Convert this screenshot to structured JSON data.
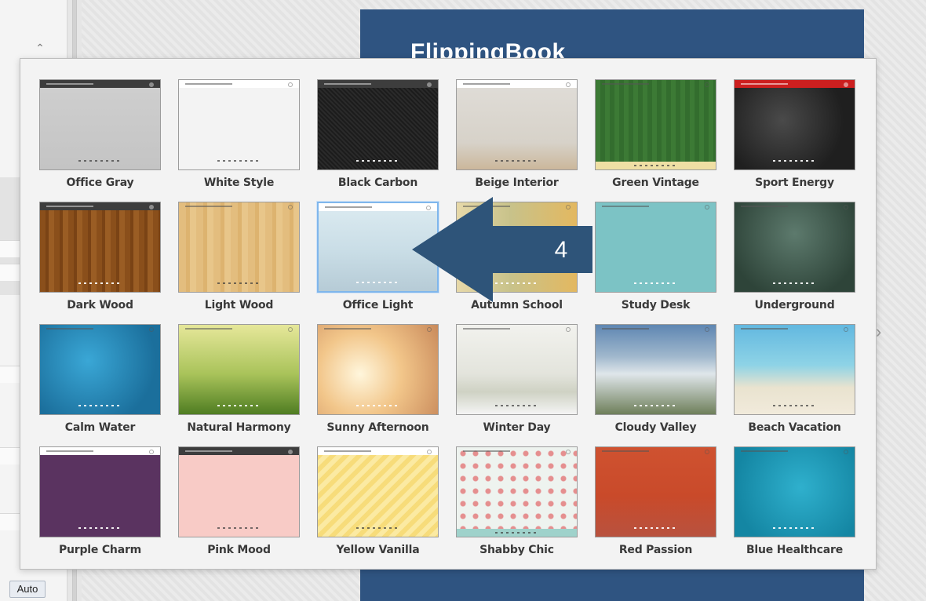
{
  "sidebar": {
    "auto_label": "Auto"
  },
  "book": {
    "logo_text": "FlippingBook"
  },
  "theme_picker": {
    "themes": [
      {
        "name": "Office Gray",
        "cls": "bg-office-gray",
        "bar": "dark",
        "icons": "dark"
      },
      {
        "name": "White Style",
        "cls": "bg-white-style",
        "bar": "light",
        "icons": "dark"
      },
      {
        "name": "Black Carbon",
        "cls": "bg-black-carbon",
        "bar": "dark",
        "icons": "light"
      },
      {
        "name": "Beige Interior",
        "cls": "bg-beige-interior",
        "bar": "light",
        "icons": "dark"
      },
      {
        "name": "Green Vintage",
        "cls": "bg-green-vintage",
        "bar": "clear",
        "icons": "band"
      },
      {
        "name": "Sport Energy",
        "cls": "bg-sport-energy",
        "bar": "red",
        "icons": "light"
      },
      {
        "name": "Dark Wood",
        "cls": "bg-dark-wood",
        "bar": "dark",
        "icons": "light"
      },
      {
        "name": "Light Wood",
        "cls": "bg-light-wood",
        "bar": "clear",
        "icons": "dark"
      },
      {
        "name": "Office Light",
        "cls": "bg-office-light",
        "bar": "light",
        "icons": "light",
        "selected": true
      },
      {
        "name": "Autumn School",
        "cls": "bg-autumn-school",
        "bar": "clear",
        "icons": "light"
      },
      {
        "name": "Study Desk",
        "cls": "bg-study-desk",
        "bar": "clear",
        "icons": "light"
      },
      {
        "name": "Underground",
        "cls": "bg-underground",
        "bar": "clear",
        "icons": "light"
      },
      {
        "name": "Calm Water",
        "cls": "bg-calm-water",
        "bar": "clear",
        "icons": "light"
      },
      {
        "name": "Natural Harmony",
        "cls": "bg-natural-harmony",
        "bar": "clear",
        "icons": "light"
      },
      {
        "name": "Sunny Afternoon",
        "cls": "bg-sunny-afternoon",
        "bar": "clear",
        "icons": "light"
      },
      {
        "name": "Winter Day",
        "cls": "bg-winter-day",
        "bar": "clear",
        "icons": "dark"
      },
      {
        "name": "Cloudy Valley",
        "cls": "bg-cloudy-valley",
        "bar": "clear",
        "icons": "light"
      },
      {
        "name": "Beach Vacation",
        "cls": "bg-beach-vacation",
        "bar": "clear",
        "icons": "dark"
      },
      {
        "name": "Purple Charm",
        "cls": "bg-purple-charm",
        "bar": "light",
        "icons": "light"
      },
      {
        "name": "Pink Mood",
        "cls": "bg-pink-mood",
        "bar": "dark",
        "icons": "dark"
      },
      {
        "name": "Yellow Vanilla",
        "cls": "bg-yellow-vanilla",
        "bar": "light",
        "icons": "dark"
      },
      {
        "name": "Shabby Chic",
        "cls": "bg-shabby-chic",
        "bar": "clear",
        "icons": "band"
      },
      {
        "name": "Red Passion",
        "cls": "bg-red-passion",
        "bar": "clear",
        "icons": "light"
      },
      {
        "name": "Blue Healthcare",
        "cls": "bg-blue-healthcare",
        "bar": "clear",
        "icons": "light"
      }
    ]
  },
  "callout": {
    "number": "4",
    "color": "#2e5479"
  },
  "colors": {
    "book_page": "#2f5481",
    "selected_border": "#7fb6ec",
    "popup_bg": "#f3f3f3"
  }
}
